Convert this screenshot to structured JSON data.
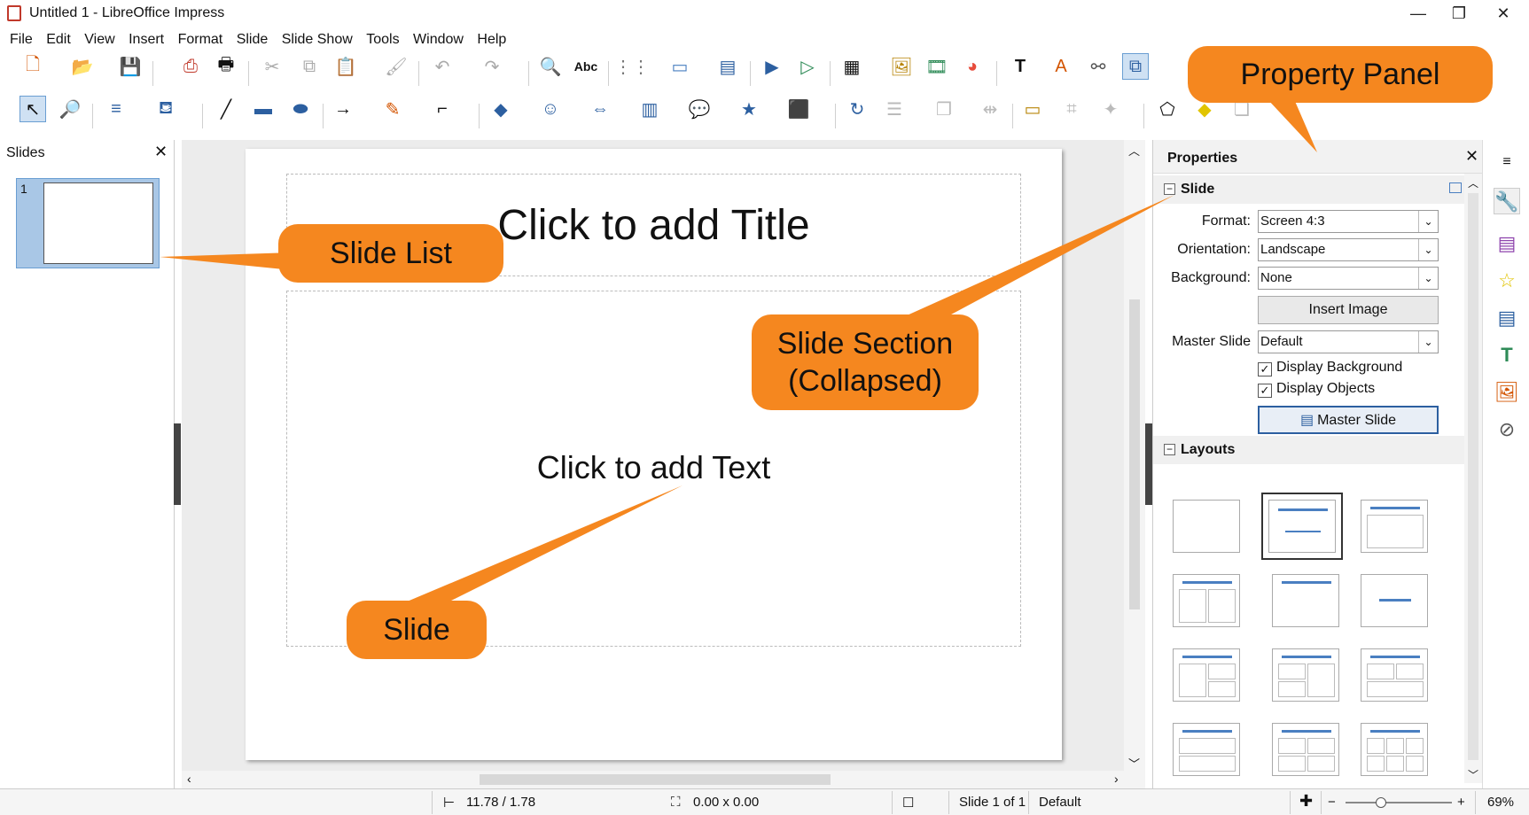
{
  "window": {
    "title": "Untitled 1 - LibreOffice Impress",
    "minimize": "—",
    "maximize": "❐",
    "close": "✕"
  },
  "menu": [
    "File",
    "Edit",
    "View",
    "Insert",
    "Format",
    "Slide",
    "Slide Show",
    "Tools",
    "Window",
    "Help"
  ],
  "slides_pane": {
    "title": "Slides",
    "close": "✕",
    "slide_number": "1"
  },
  "slide": {
    "title_placeholder": "Click to add Title",
    "text_placeholder": "Click to add Text"
  },
  "properties": {
    "title": "Properties",
    "close": "✕",
    "slide_section": {
      "label": "Slide",
      "toggle": "−",
      "format_label": "Format:",
      "format_value": "Screen 4:3",
      "orientation_label": "Orientation:",
      "orientation_value": "Landscape",
      "background_label": "Background:",
      "background_value": "None",
      "insert_image": "Insert Image",
      "master_slide_label": "Master Slide",
      "master_slide_value": "Default",
      "display_background": "Display Background",
      "display_objects": "Display Objects",
      "master_slide_button": "Master Slide"
    },
    "layouts_section": {
      "label": "Layouts",
      "toggle": "−"
    }
  },
  "status": {
    "position": "11.78 / 1.78",
    "size": "0.00 x 0.00",
    "slide_info": "Slide 1 of 1",
    "master": "Default",
    "zoom": "69%"
  },
  "callouts": {
    "property_panel": "Property Panel",
    "slide_list": "Slide List",
    "slide_section_line1": "Slide Section",
    "slide_section_line2": "(Collapsed)",
    "slide": "Slide"
  },
  "colors": {
    "callout": "#f5871f",
    "selection": "#a9c7e6",
    "layout_accent": "#4a7fc1"
  }
}
